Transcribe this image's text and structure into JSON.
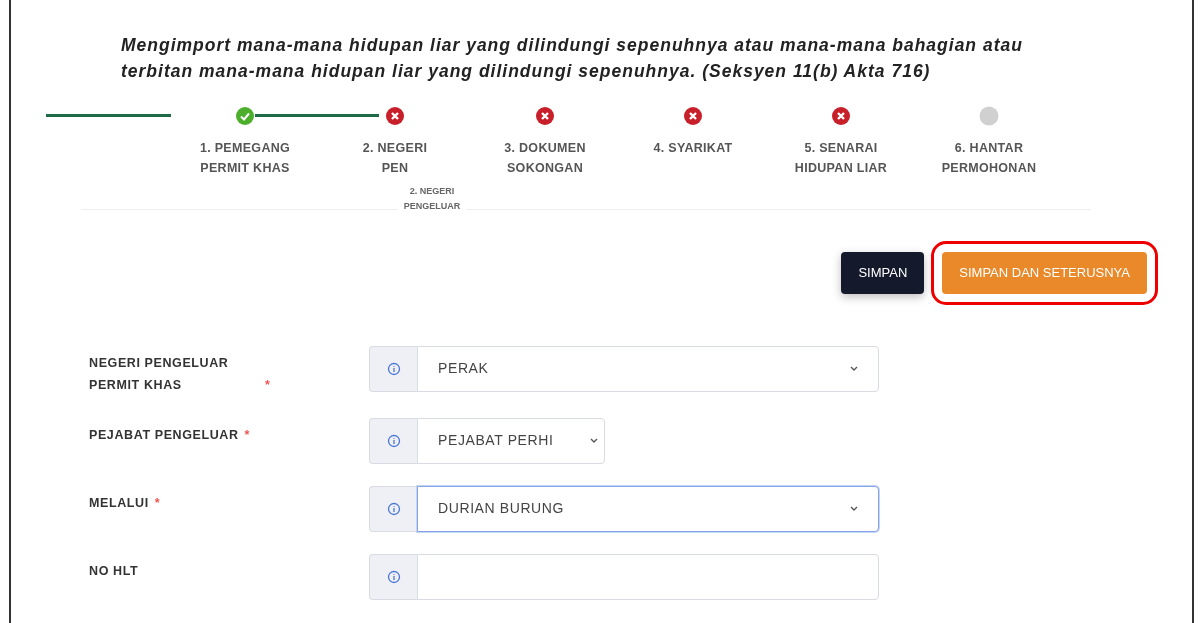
{
  "heading": "Mengimport mana-mana hidupan liar yang dilindungi sepenuhnya atau mana-mana bahagian atau terbitan mana-mana hidupan liar yang dilindungi sepenuhnya. (Seksyen 11(b) Akta 716)",
  "steps": [
    {
      "lines": [
        "1. PEMEGANG",
        "PERMIT KHAS"
      ],
      "done": true,
      "error": false
    },
    {
      "lines": [
        "2. NEGERI",
        "PEN"
      ],
      "done": false,
      "error": true,
      "tooltip": "2. NEGERI PENGELUAR"
    },
    {
      "lines": [
        "3. DOKUMEN",
        "SOKONGAN"
      ],
      "done": false,
      "error": true
    },
    {
      "lines": [
        "4. SYARIKAT"
      ],
      "done": false,
      "error": true
    },
    {
      "lines": [
        "5. SENARAI",
        "HIDUPAN LIAR"
      ],
      "done": false,
      "error": true
    },
    {
      "lines": [
        "6. HANTAR",
        "PERMOHONAN"
      ],
      "done": false,
      "error": false
    }
  ],
  "buttons": [
    {
      "label": "SIMPAN",
      "kind": "dark",
      "highlighted": false
    },
    {
      "label": "SIMPAN DAN SETERUSNYA",
      "kind": "orange",
      "highlighted": true
    }
  ],
  "fields": [
    {
      "label": "NEGERI PENGELUAR PERMIT KHAS",
      "required_mark": "*",
      "kind": "select",
      "value": "PERAK",
      "focused": false
    },
    {
      "label": "PEJABAT PENGELUAR",
      "required_mark": "*",
      "kind": "select",
      "value": "PEJABAT PERHI",
      "focused": false
    },
    {
      "label": "MELALUI",
      "required_mark": "*",
      "kind": "select",
      "value": "DURIAN BURUNG",
      "focused": true
    },
    {
      "label": "NO HLT",
      "kind": "text",
      "focused": false
    }
  ]
}
